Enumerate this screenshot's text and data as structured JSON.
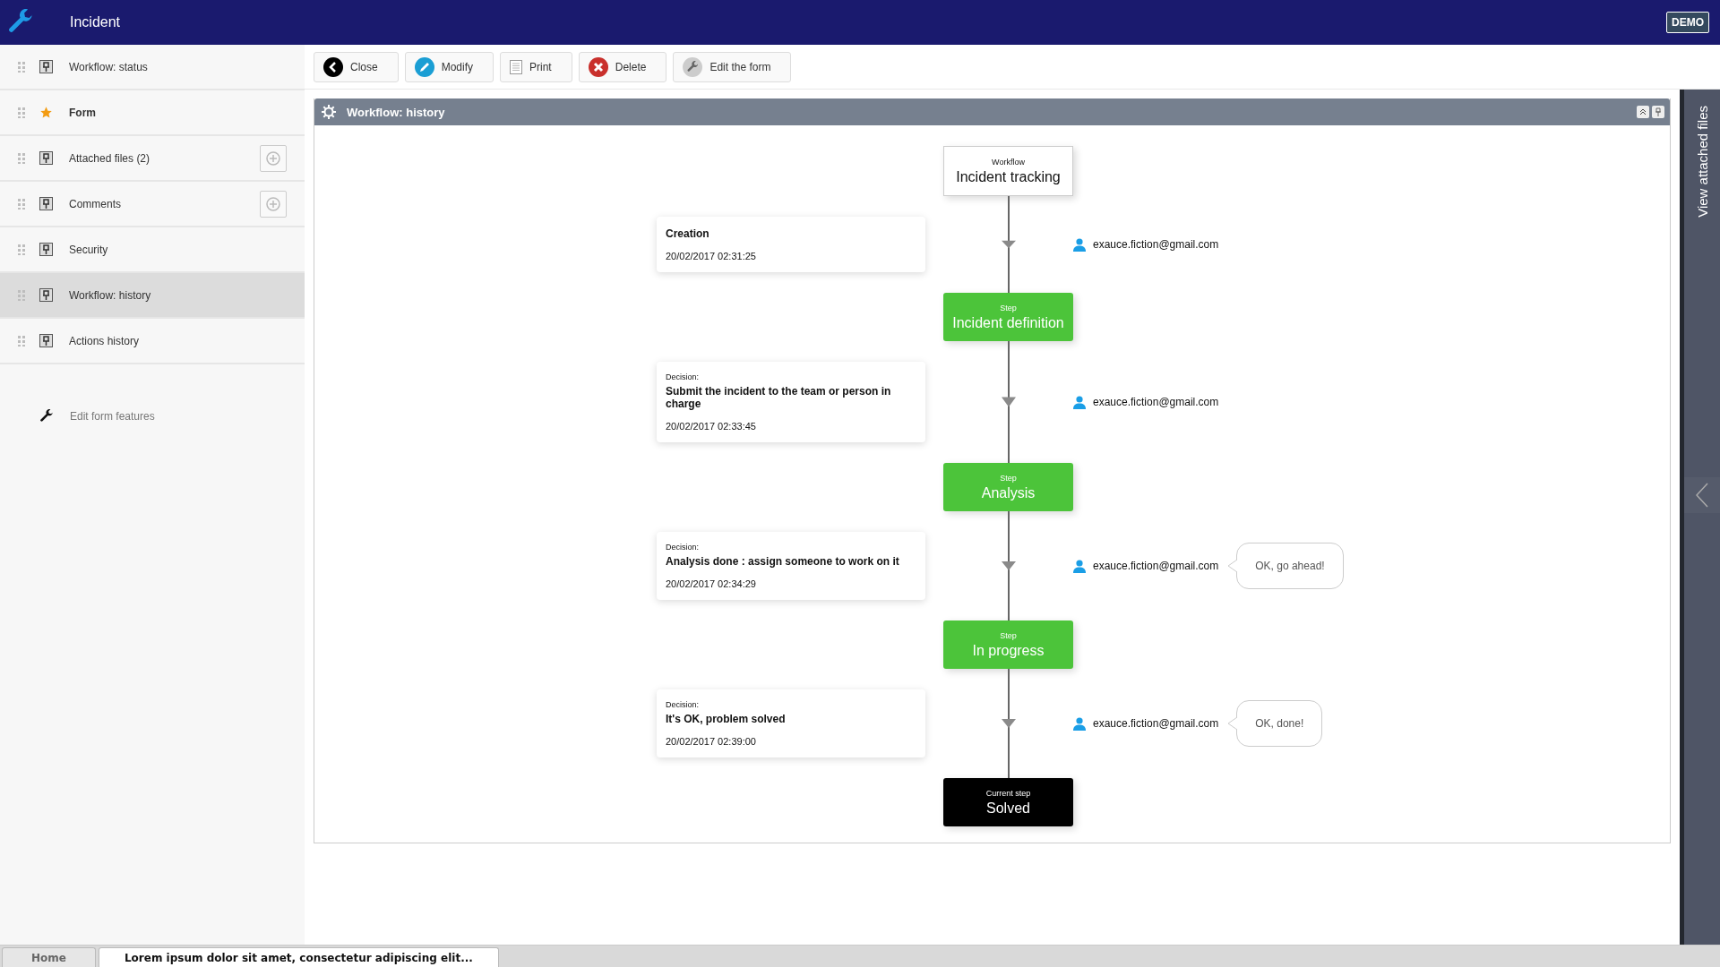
{
  "header": {
    "title": "Incident",
    "badge": "DEMO"
  },
  "sidebar": {
    "items": [
      {
        "label": "Workflow: status",
        "kind": "pin",
        "selected": false,
        "addable": false
      },
      {
        "label": "Form",
        "kind": "star",
        "selected": false,
        "addable": false
      },
      {
        "label": "Attached files (2)",
        "kind": "pin",
        "selected": false,
        "addable": true
      },
      {
        "label": "Comments",
        "kind": "pin",
        "selected": false,
        "addable": true
      },
      {
        "label": "Security",
        "kind": "pin",
        "selected": false,
        "addable": false
      },
      {
        "label": "Workflow: history",
        "kind": "pin",
        "selected": true,
        "addable": false
      },
      {
        "label": "Actions history",
        "kind": "pin",
        "selected": false,
        "addable": false
      }
    ],
    "edit_link": "Edit form features"
  },
  "toolbar": [
    {
      "label": "Close",
      "kind": "close"
    },
    {
      "label": "Modify",
      "kind": "modify"
    },
    {
      "label": "Print",
      "kind": "print"
    },
    {
      "label": "Delete",
      "kind": "delete"
    },
    {
      "label": "Edit the form",
      "kind": "edit"
    }
  ],
  "panel": {
    "title": "Workflow: history",
    "flow": [
      {
        "kind": "start",
        "label": "Workflow",
        "name": "Incident tracking"
      },
      {
        "kind": "transition",
        "title": "Creation",
        "date": "20/02/2017 02:31:25",
        "user": "exauce.fiction@gmail.com"
      },
      {
        "kind": "step",
        "label": "Step",
        "name": "Incident definition"
      },
      {
        "kind": "transition",
        "label": "Decision:",
        "title": "Submit the incident to the team or person in charge",
        "date": "20/02/2017 02:33:45",
        "user": "exauce.fiction@gmail.com"
      },
      {
        "kind": "step",
        "label": "Step",
        "name": "Analysis"
      },
      {
        "kind": "transition",
        "label": "Decision:",
        "title": "Analysis done : assign someone to work on it",
        "date": "20/02/2017 02:34:29",
        "user": "exauce.fiction@gmail.com",
        "comment": "OK, go ahead!"
      },
      {
        "kind": "step",
        "label": "Step",
        "name": "In progress"
      },
      {
        "kind": "transition",
        "label": "Decision:",
        "title": "It's OK, problem solved",
        "date": "20/02/2017 02:39:00",
        "user": "exauce.fiction@gmail.com",
        "comment": "OK, done!"
      },
      {
        "kind": "current",
        "label": "Current step",
        "name": "Solved"
      }
    ]
  },
  "side_rail": {
    "label": "View attached files"
  },
  "bottom_tabs": [
    {
      "label": "Home",
      "selected": false
    },
    {
      "label": "Lorem ipsum dolor sit amet, consectetur adipiscing elit...",
      "selected": true
    }
  ]
}
